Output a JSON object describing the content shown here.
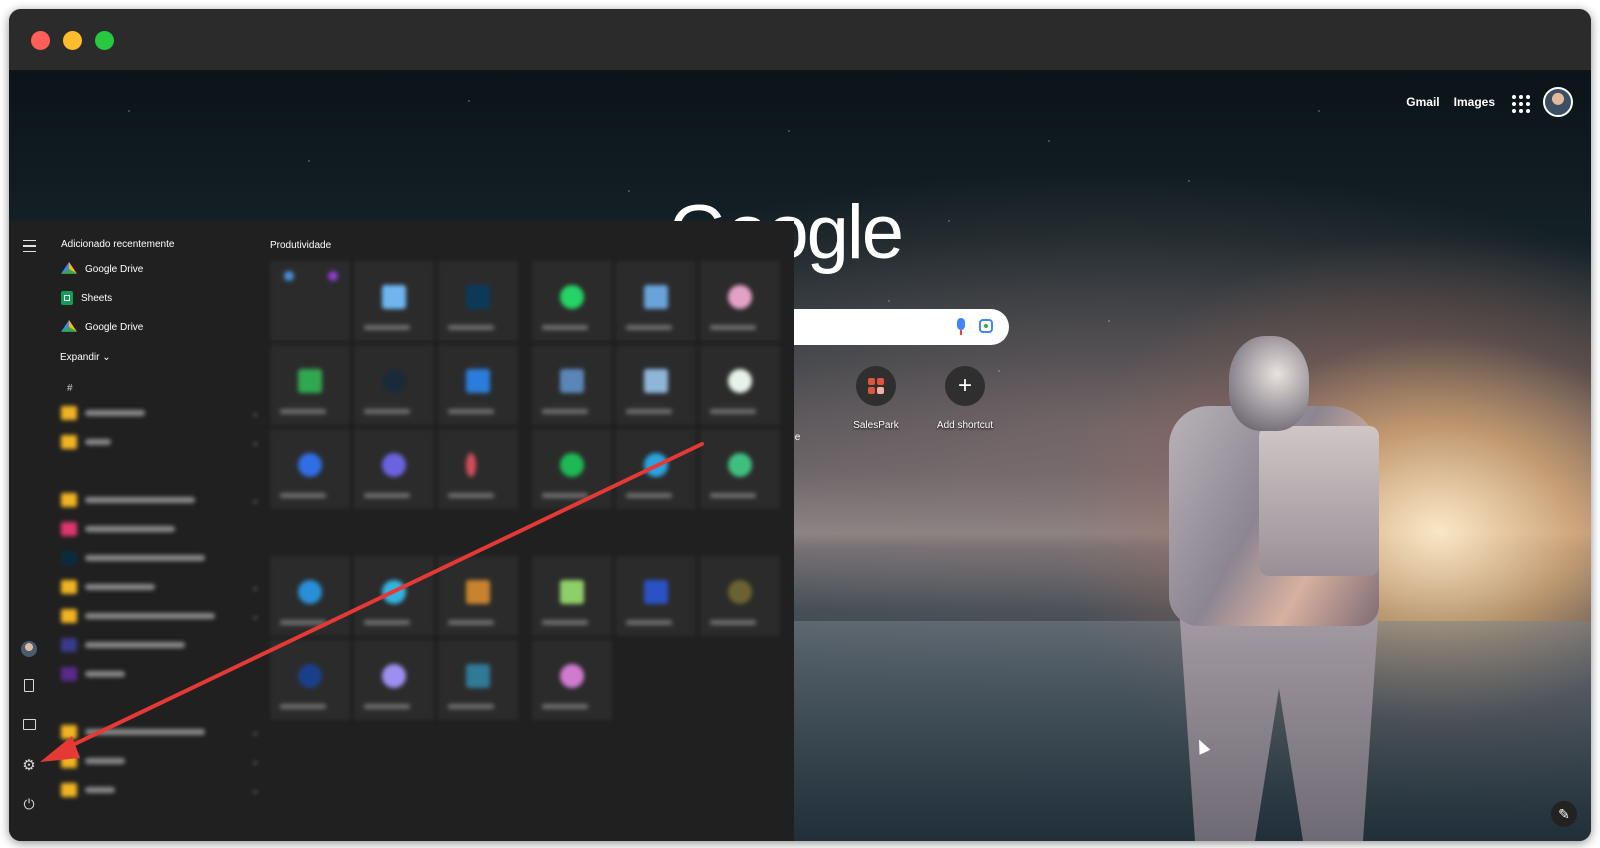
{
  "browser": {
    "header_links": [
      "Gmail",
      "Images"
    ],
    "logo_text": "Google",
    "shortcuts": [
      {
        "label": "SalesPark",
        "icon": "salespark-icon"
      },
      {
        "label": "Add shortcut",
        "icon": "plus-icon"
      }
    ],
    "partial_shortcut_label": "ble"
  },
  "start_menu": {
    "recent_title": "Adicionado recentemente",
    "recent_items": [
      {
        "label": "Google Drive",
        "icon": "google-drive-icon"
      },
      {
        "label": "Sheets",
        "icon": "sheets-icon"
      },
      {
        "label": "Google Drive",
        "icon": "google-drive-icon"
      }
    ],
    "expand_label": "Expandir",
    "hash_label": "#",
    "group_title": "Produtividade"
  },
  "colors": {
    "accent": "#4285f4",
    "annotation_arrow": "#e53935",
    "menu_bg": "#202020"
  }
}
